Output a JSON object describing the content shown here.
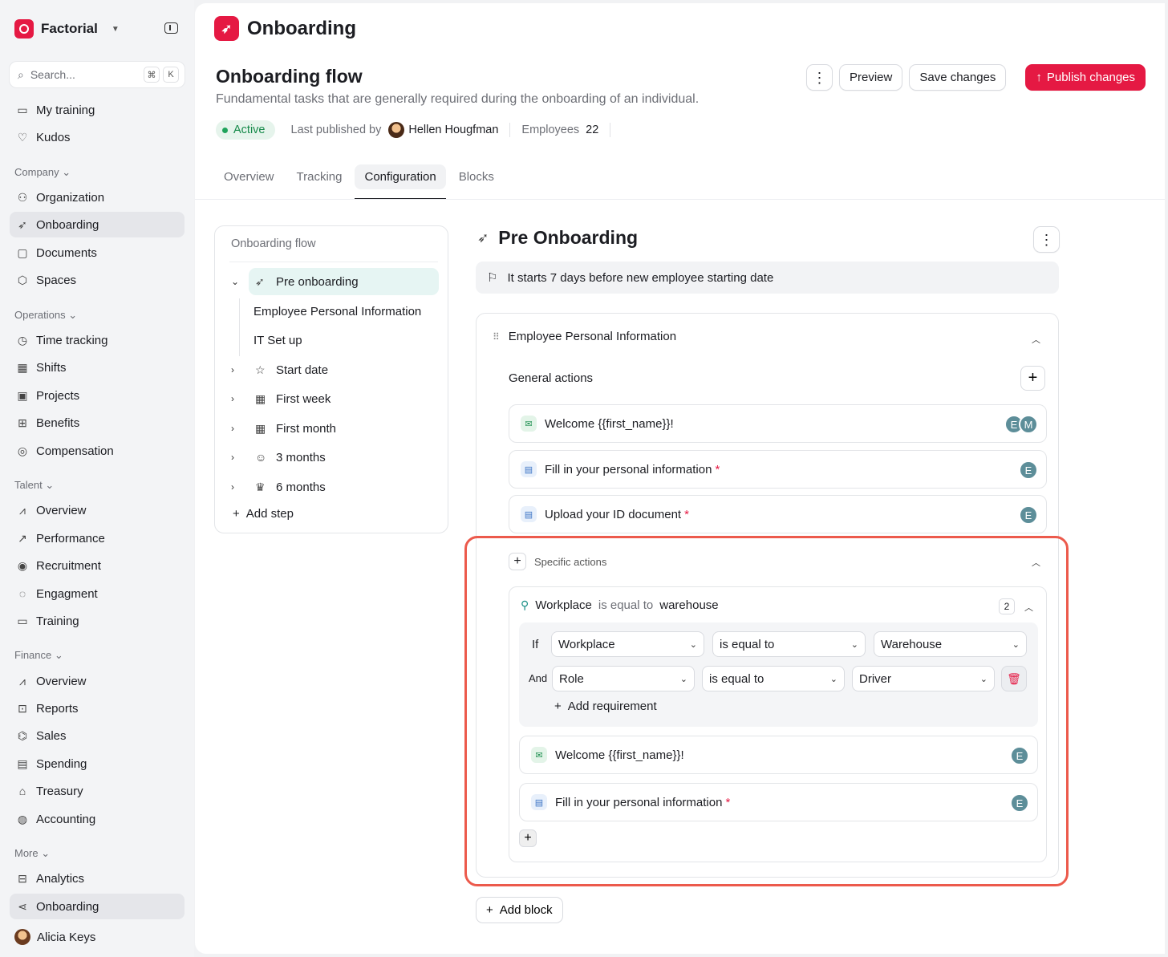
{
  "app": {
    "name": "Factorial"
  },
  "search": {
    "placeholder": "Search...",
    "kbd_cmd": "⌘",
    "kbd_key": "K"
  },
  "sidebar": {
    "top_items": [
      {
        "label": "My training",
        "icon": "book-icon"
      },
      {
        "label": "Kudos",
        "icon": "heart-icon"
      }
    ],
    "sections": [
      {
        "label": "Company",
        "items": [
          {
            "label": "Organization",
            "icon": "people-icon"
          },
          {
            "label": "Onboarding",
            "icon": "rocket-icon",
            "active": true
          },
          {
            "label": "Documents",
            "icon": "folder-icon"
          },
          {
            "label": "Spaces",
            "icon": "cube-icon"
          }
        ]
      },
      {
        "label": "Operations",
        "items": [
          {
            "label": "Time tracking",
            "icon": "stopwatch-icon"
          },
          {
            "label": "Shifts",
            "icon": "calendar-clock-icon"
          },
          {
            "label": "Projects",
            "icon": "briefcase-icon"
          },
          {
            "label": "Benefits",
            "icon": "gift-icon"
          },
          {
            "label": "Compensation",
            "icon": "coin-icon"
          }
        ]
      },
      {
        "label": "Talent",
        "items": [
          {
            "label": "Overview",
            "icon": "chart-icon"
          },
          {
            "label": "Performance",
            "icon": "trend-icon"
          },
          {
            "label": "Recruitment",
            "icon": "magnifier-person-icon"
          },
          {
            "label": "Engagment",
            "icon": "chat-heart-icon"
          },
          {
            "label": "Training",
            "icon": "book-icon"
          }
        ]
      },
      {
        "label": "Finance",
        "items": [
          {
            "label": "Overview",
            "icon": "chart-icon"
          },
          {
            "label": "Reports",
            "icon": "presentation-icon"
          },
          {
            "label": "Sales",
            "icon": "tag-icon"
          },
          {
            "label": "Spending",
            "icon": "wallet-icon"
          },
          {
            "label": "Treasury",
            "icon": "bank-icon"
          },
          {
            "label": "Accounting",
            "icon": "money-bag-icon"
          }
        ]
      },
      {
        "label": "More",
        "items": [
          {
            "label": "Analytics",
            "icon": "analytics-icon"
          },
          {
            "label": "Onboarding",
            "icon": "flow-icon",
            "active": true
          }
        ]
      }
    ],
    "user": {
      "name": "Alicia Keys"
    }
  },
  "page": {
    "title": "Onboarding",
    "flow_title": "Onboarding flow",
    "flow_description": "Fundamental tasks that are generally required during the onboarding of an individual.",
    "status": "Active",
    "last_published_label": "Last published by",
    "author": "Hellen Hougfman",
    "employees_label": "Employees",
    "employees_count": "22",
    "buttons": {
      "more": "⋮",
      "preview": "Preview",
      "save": "Save changes",
      "publish": "Publish changes"
    },
    "tabs": [
      {
        "label": "Overview"
      },
      {
        "label": "Tracking"
      },
      {
        "label": "Configuration",
        "active": true
      },
      {
        "label": "Blocks"
      }
    ]
  },
  "flow_tree": {
    "title": "Onboarding flow",
    "steps": [
      {
        "label": "Pre onboarding",
        "icon": "rocket-icon",
        "expanded": true,
        "active": true,
        "children": [
          "Employee Personal Information",
          "IT Set up"
        ]
      },
      {
        "label": "Start date",
        "icon": "star-icon"
      },
      {
        "label": "First week",
        "icon": "calendar-icon"
      },
      {
        "label": "First month",
        "icon": "calendar-icon"
      },
      {
        "label": "3 months",
        "icon": "smile-icon"
      },
      {
        "label": "6 months",
        "icon": "crown-icon"
      }
    ],
    "add_step": "Add step"
  },
  "detail": {
    "title": "Pre Onboarding",
    "starts": "It starts 7 days before new employee starting date",
    "block": {
      "title": "Employee Personal Information",
      "general_label": "General actions",
      "general_actions": [
        {
          "label": "Welcome {{first_name}}!",
          "type": "mail",
          "required": false,
          "assignees": [
            "E",
            "M"
          ]
        },
        {
          "label": "Fill in your personal information",
          "type": "doc",
          "required": true,
          "assignees": [
            "E"
          ]
        },
        {
          "label": "Upload your ID document",
          "type": "doc",
          "required": true,
          "assignees": [
            "E"
          ]
        }
      ],
      "specific_label": "Specific actions",
      "condition": {
        "field": "Workplace",
        "operator": "is equal to",
        "value": "warehouse",
        "count": "2",
        "rules": [
          {
            "connector": "If",
            "field": "Workplace",
            "operator": "is equal to",
            "value": "Warehouse"
          },
          {
            "connector": "And",
            "field": "Role",
            "operator": "is equal to",
            "value": "Driver"
          }
        ],
        "add_requirement": "Add requirement",
        "actions": [
          {
            "label": "Welcome {{first_name}}!",
            "type": "mail",
            "required": false,
            "assignees": [
              "E"
            ]
          },
          {
            "label": "Fill in your personal information",
            "type": "doc",
            "required": true,
            "assignees": [
              "E"
            ]
          }
        ]
      }
    },
    "add_block": "Add block"
  },
  "colors": {
    "brand": "#e51943",
    "highlight": "#ec5a4c",
    "active_green": "#1fa35b",
    "avatar": "#5d8e99"
  }
}
